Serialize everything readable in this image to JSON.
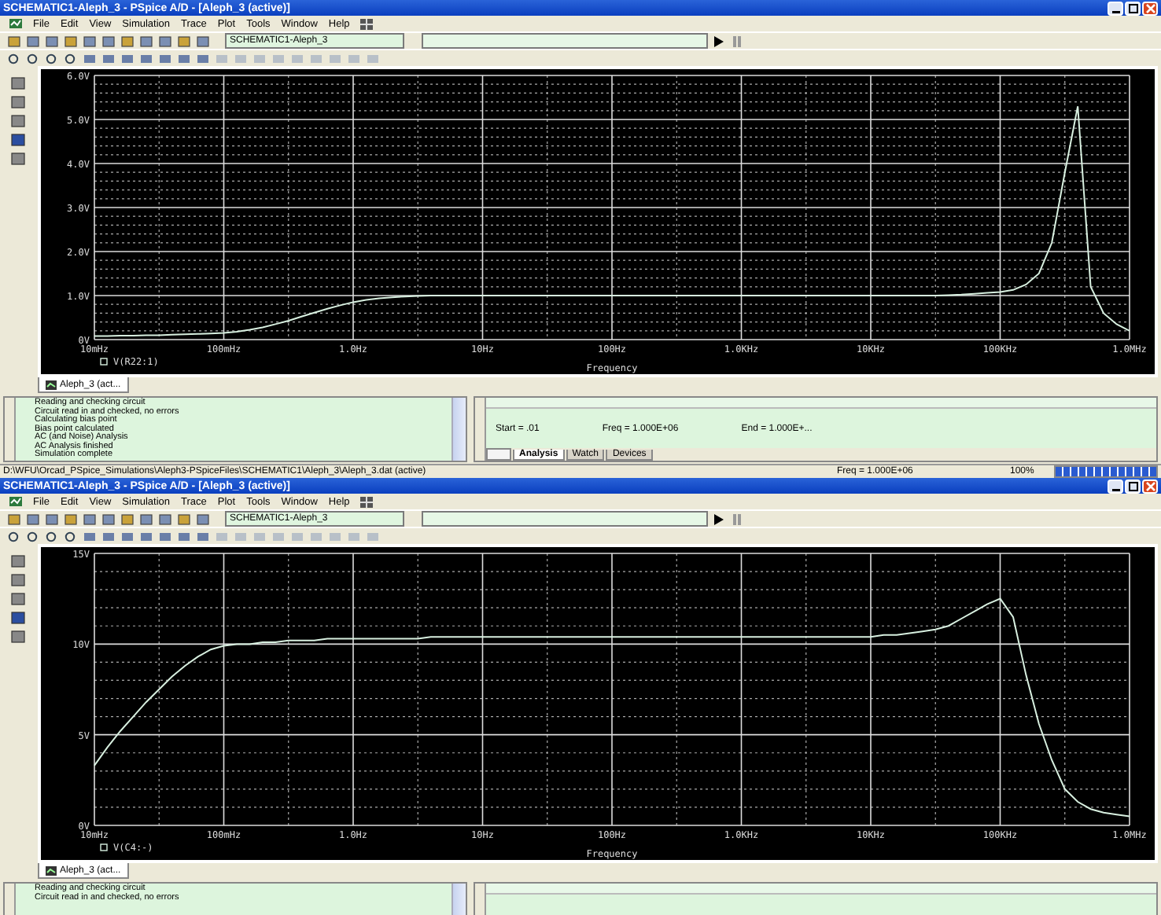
{
  "windows": [
    {
      "title": "SCHEMATIC1-Aleph_3 - PSpice A/D - [Aleph_3 (active)]",
      "menu": [
        "File",
        "Edit",
        "View",
        "Simulation",
        "Trace",
        "Plot",
        "Tools",
        "Window",
        "Help"
      ],
      "profile": "SCHEMATIC1-Aleph_3",
      "plot": {
        "tab": "Aleph_3 (act...",
        "chart_data": {
          "type": "line",
          "xlabel": "Frequency",
          "ylim": [
            0,
            6
          ],
          "grid": true,
          "categories": [
            "10mHz",
            null,
            null,
            null,
            null,
            null,
            null,
            null,
            null,
            null,
            "100mHz",
            null,
            null,
            null,
            null,
            null,
            null,
            null,
            null,
            null,
            "1.0Hz",
            null,
            null,
            null,
            null,
            null,
            null,
            null,
            null,
            null,
            "10Hz",
            null,
            null,
            null,
            null,
            null,
            null,
            null,
            null,
            null,
            "100Hz",
            null,
            null,
            null,
            null,
            null,
            null,
            null,
            null,
            null,
            "1.0KHz",
            null,
            null,
            null,
            null,
            null,
            null,
            null,
            null,
            null,
            "10KHz",
            null,
            null,
            null,
            null,
            null,
            null,
            null,
            null,
            null,
            "100KHz",
            null,
            null,
            null,
            null,
            null,
            null,
            null,
            null,
            null,
            "1.0MHz"
          ],
          "series": [
            {
              "name": "V(R22:1)",
              "color": "#d8f0e0",
              "values": [
                0.08,
                0.08,
                0.09,
                0.09,
                0.1,
                0.1,
                0.11,
                0.12,
                0.13,
                0.14,
                0.15,
                0.18,
                0.22,
                0.28,
                0.35,
                0.43,
                0.52,
                0.61,
                0.7,
                0.78,
                0.85,
                0.9,
                0.94,
                0.96,
                0.98,
                0.99,
                1.0,
                1.0,
                1.0,
                1.0,
                1.0,
                1.0,
                1.0,
                1.0,
                1.0,
                1.0,
                1.0,
                1.0,
                1.0,
                1.0,
                1.0,
                1.0,
                1.0,
                1.0,
                1.0,
                1.0,
                1.0,
                1.0,
                1.0,
                1.0,
                1.0,
                1.0,
                1.0,
                1.0,
                1.0,
                1.0,
                1.0,
                1.0,
                1.0,
                1.0,
                1.0,
                1.0,
                1.0,
                1.0,
                1.0,
                1.0,
                1.01,
                1.02,
                1.04,
                1.06,
                1.08,
                1.13,
                1.25,
                1.5,
                2.2,
                3.8,
                5.3,
                1.2,
                0.6,
                0.35,
                0.2
              ]
            }
          ],
          "yticks": [
            {
              "value": 0,
              "label": "0V"
            },
            {
              "value": 1,
              "label": "1.0V"
            },
            {
              "value": 2,
              "label": "2.0V"
            },
            {
              "value": 3,
              "label": "3.0V"
            },
            {
              "value": 4,
              "label": "4.0V"
            },
            {
              "value": 5,
              "label": "5.0V"
            },
            {
              "value": 6,
              "label": "6.0V"
            }
          ]
        }
      },
      "output": [
        "Reading and checking circuit",
        "Circuit read in and checked, no errors",
        "Calculating bias point",
        "Bias point calculated",
        "AC (and Noise) Analysis",
        "AC Analysis finished",
        "Simulation complete"
      ],
      "sim": {
        "readings": [
          "Start = .01",
          "Freq = 1.000E+06",
          "End = 1.000E+..."
        ],
        "tabs": [
          {
            "label": "Analysis",
            "selected": true
          },
          {
            "label": "Watch",
            "selected": false
          },
          {
            "label": "Devices",
            "selected": false
          }
        ]
      },
      "status_bar": {
        "path": "D:\\WFU\\Orcad_PSpice_Simulations\\Aleph3-PSpiceFiles\\SCHEMATIC1\\Aleph_3\\Aleph_3.dat (active)",
        "freq": "Freq = 1.000E+06",
        "zoom": "100%",
        "level": 1
      }
    },
    {
      "title": "SCHEMATIC1-Aleph_3 - PSpice A/D - [Aleph_3 (active)]",
      "menu": [
        "File",
        "Edit",
        "View",
        "Simulation",
        "Trace",
        "Plot",
        "Tools",
        "Window",
        "Help"
      ],
      "profile": "SCHEMATIC1-Aleph_3",
      "plot": {
        "tab": "Aleph_3 (act...",
        "chart_data": {
          "type": "line",
          "xlabel": "Frequency",
          "ylim": [
            0,
            15
          ],
          "grid": true,
          "categories": [
            "10mHz",
            null,
            null,
            null,
            null,
            null,
            null,
            null,
            null,
            null,
            "100mHz",
            null,
            null,
            null,
            null,
            null,
            null,
            null,
            null,
            null,
            "1.0Hz",
            null,
            null,
            null,
            null,
            null,
            null,
            null,
            null,
            null,
            "10Hz",
            null,
            null,
            null,
            null,
            null,
            null,
            null,
            null,
            null,
            "100Hz",
            null,
            null,
            null,
            null,
            null,
            null,
            null,
            null,
            null,
            "1.0KHz",
            null,
            null,
            null,
            null,
            null,
            null,
            null,
            null,
            null,
            "10KHz",
            null,
            null,
            null,
            null,
            null,
            null,
            null,
            null,
            null,
            "100KHz",
            null,
            null,
            null,
            null,
            null,
            null,
            null,
            null,
            null,
            "1.0MHz"
          ],
          "series": [
            {
              "name": "V(C4:-)",
              "color": "#d8f0e0",
              "values": [
                3.3,
                4.3,
                5.2,
                6.0,
                6.8,
                7.5,
                8.2,
                8.8,
                9.3,
                9.7,
                9.9,
                10.0,
                10.0,
                10.1,
                10.1,
                10.2,
                10.2,
                10.2,
                10.3,
                10.3,
                10.3,
                10.3,
                10.3,
                10.3,
                10.3,
                10.3,
                10.4,
                10.4,
                10.4,
                10.4,
                10.4,
                10.4,
                10.4,
                10.4,
                10.4,
                10.4,
                10.4,
                10.4,
                10.4,
                10.4,
                10.4,
                10.4,
                10.4,
                10.4,
                10.4,
                10.4,
                10.4,
                10.4,
                10.4,
                10.4,
                10.4,
                10.4,
                10.4,
                10.4,
                10.4,
                10.4,
                10.4,
                10.4,
                10.4,
                10.4,
                10.4,
                10.5,
                10.5,
                10.6,
                10.7,
                10.8,
                11.0,
                11.4,
                11.8,
                12.2,
                12.5,
                11.5,
                8.3,
                5.6,
                3.6,
                2.0,
                1.3,
                0.9,
                0.7,
                0.6,
                0.5
              ]
            }
          ],
          "yticks": [
            {
              "value": 0,
              "label": "0V"
            },
            {
              "value": 5,
              "label": "5V"
            },
            {
              "value": 10,
              "label": "10V"
            },
            {
              "value": 15,
              "label": "15V"
            }
          ]
        }
      },
      "output": [
        "Reading and checking circuit",
        "Circuit read in and checked, no errors"
      ]
    }
  ]
}
